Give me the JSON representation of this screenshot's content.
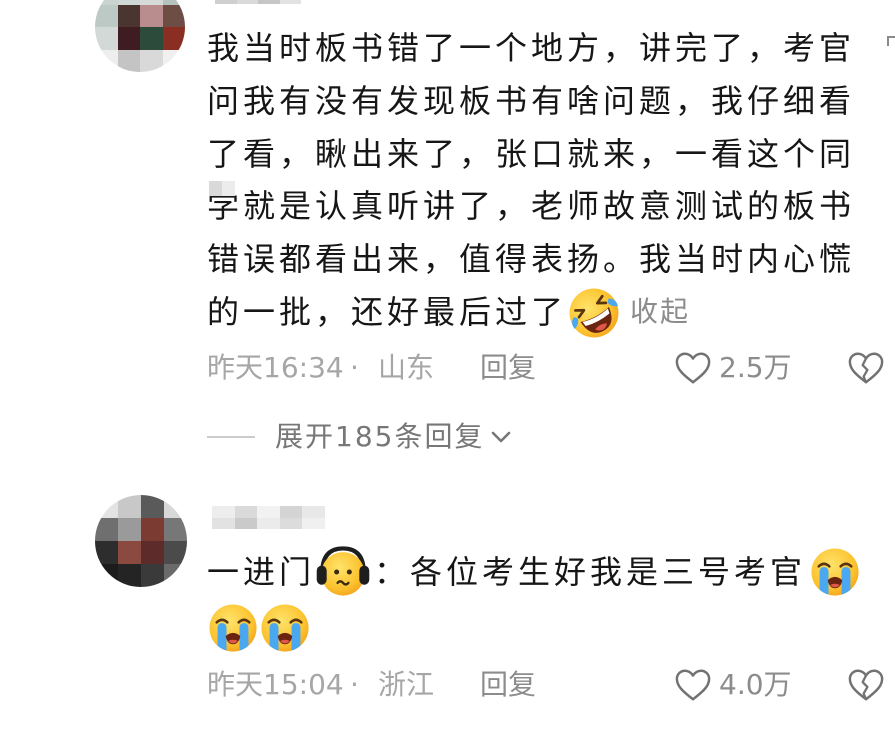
{
  "colors": {
    "background": "#ffffff",
    "comment_text": "#161616",
    "meta_text": "#a6a6a6",
    "secondary_text": "#8c8c8c",
    "expand_text": "#777777",
    "icon": "#727272",
    "divider": "#cccccc"
  },
  "comments": [
    {
      "lines": [
        "我当时板书错了一个地方，讲完了，考官",
        "问我有没有发现板书有啥问题，我仔细看",
        "了看，瞅出来了，张口就来，一看这个同",
        "学就是认真听讲了，老师故意测试的板书",
        "错误都看出来，值得表扬。我当时内心慌",
        "的一批，还好最后过了"
      ],
      "trailing_emoji": "rolling-on-the-floor-laughing-emoji",
      "collapse_label": "收起",
      "time": "昨天16:34",
      "dot": "·",
      "location": "山东",
      "reply_label": "回复",
      "like_icon": "heart-outline-icon",
      "like_count": "2.5万",
      "dislike_icon": "broken-heart-icon"
    },
    {
      "line_1": [
        {
          "text": "一进门"
        },
        {
          "emoji": "headphones-face-emoji"
        },
        {
          "text": "：各位考生好我是三号考官"
        },
        {
          "emoji": "loudly-crying-face-emoji"
        }
      ],
      "line_2": [
        {
          "emoji": "loudly-crying-face-emoji"
        },
        {
          "emoji": "loudly-crying-face-emoji"
        }
      ],
      "time": "昨天15:04",
      "dot": "·",
      "location": "浙江",
      "reply_label": "回复",
      "like_icon": "heart-outline-icon",
      "like_count": "4.0万",
      "dislike_icon": "broken-heart-icon"
    }
  ],
  "replies_toggle": {
    "label": "展开185条回复",
    "icon": "chevron-down-icon"
  }
}
